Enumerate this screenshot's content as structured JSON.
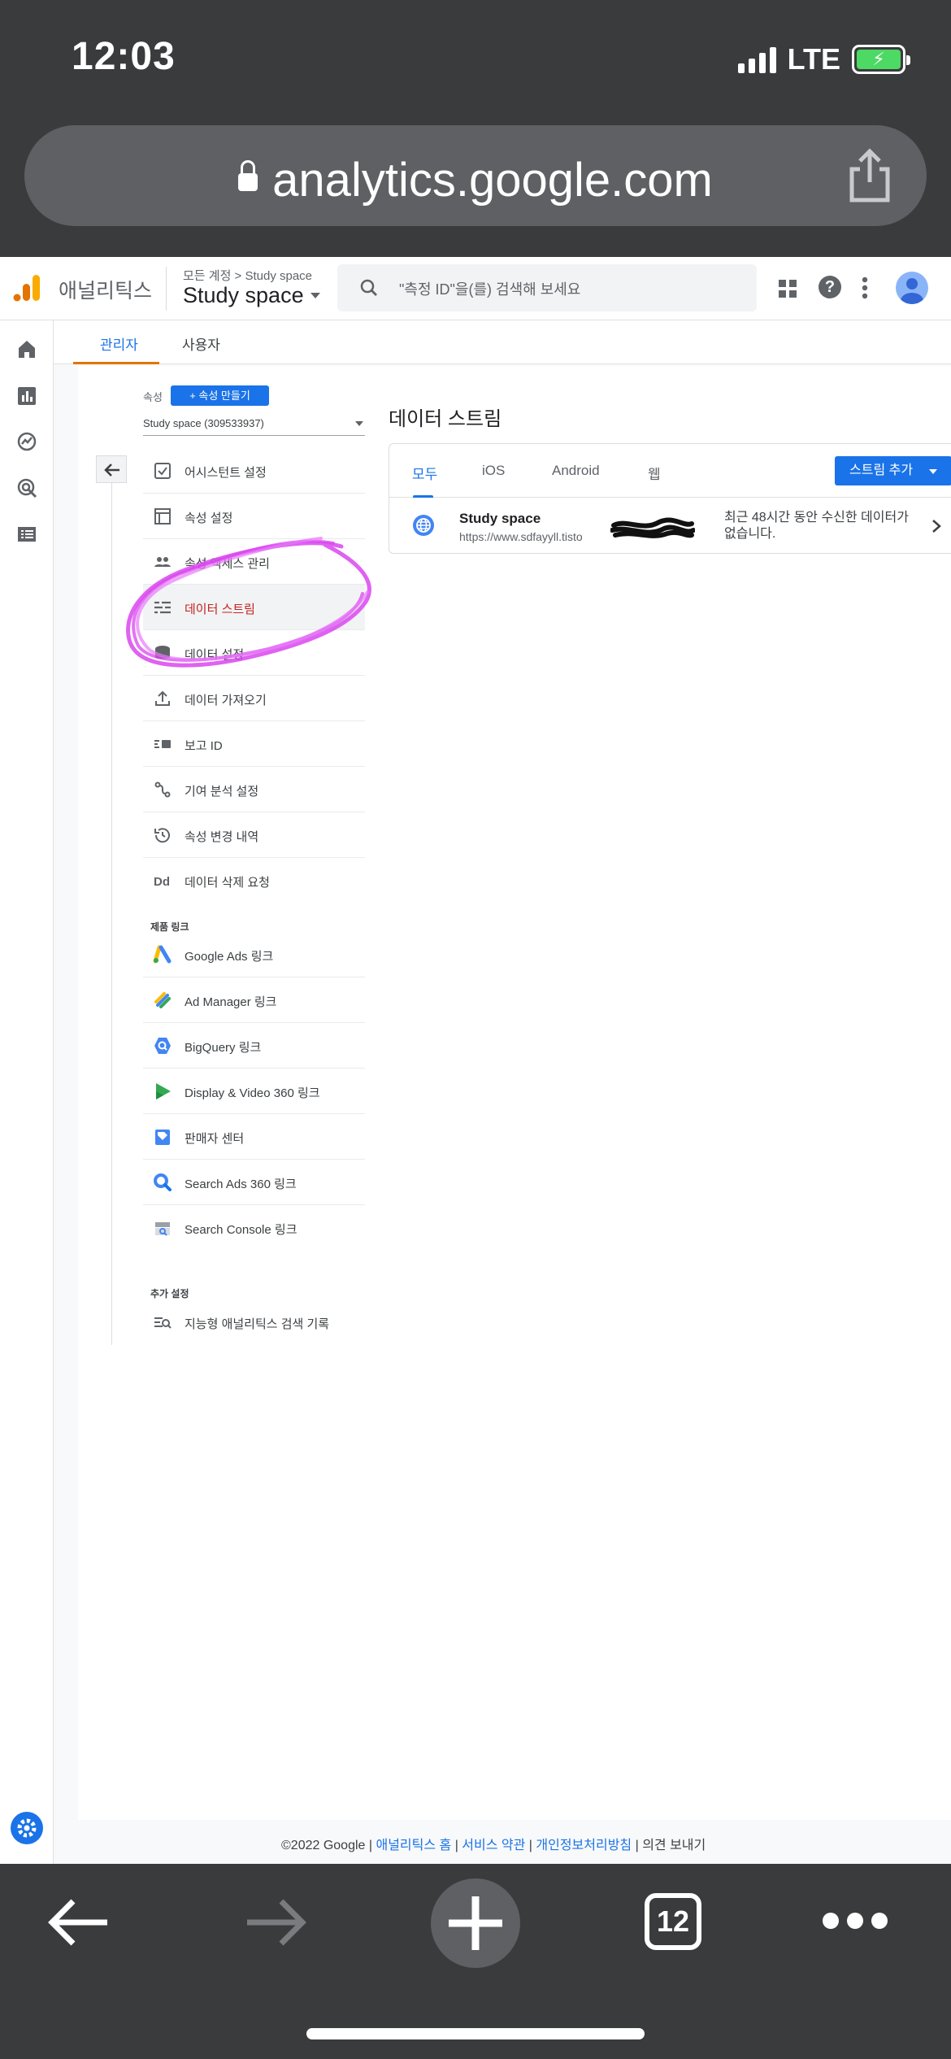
{
  "status_bar": {
    "time": "12:03",
    "network": "LTE"
  },
  "browser": {
    "url": "analytics.google.com",
    "tab_count": "12"
  },
  "header": {
    "brand": "애널리틱스",
    "account_breadcrumb": "모든 계정 > Study space",
    "account_name": "Study space",
    "search_placeholder": "\"측정 ID\"을(를) 검색해 보세요"
  },
  "admin_tabs": [
    {
      "label": "관리자",
      "active": true
    },
    {
      "label": "사용자",
      "active": false
    }
  ],
  "property": {
    "label": "속성",
    "create_button": "+ 속성 만들기",
    "selected": "Study space (309533937)"
  },
  "menu": {
    "items": [
      {
        "label": "어시스턴트 설정",
        "icon": "checklist-icon"
      },
      {
        "label": "속성 설정",
        "icon": "property-settings-icon"
      },
      {
        "label": "속성 액세스 관리",
        "icon": "people-icon"
      },
      {
        "label": "데이터 스트림",
        "icon": "data-stream-icon",
        "active": true
      },
      {
        "label": "데이터 설정",
        "icon": "database-icon"
      },
      {
        "label": "데이터 가져오기",
        "icon": "upload-icon"
      },
      {
        "label": "보고 ID",
        "icon": "reporting-id-icon"
      },
      {
        "label": "기여 분석 설정",
        "icon": "attribution-icon"
      },
      {
        "label": "속성 변경 내역",
        "icon": "history-icon"
      },
      {
        "label": "데이터 삭제 요청",
        "icon": "data-deletion-icon"
      }
    ],
    "product_links_header": "제품 링크",
    "product_links": [
      {
        "label": "Google Ads 링크",
        "icon": "google-ads-icon"
      },
      {
        "label": "Ad Manager 링크",
        "icon": "ad-manager-icon"
      },
      {
        "label": "BigQuery 링크",
        "icon": "bigquery-icon"
      },
      {
        "label": "Display & Video 360 링크",
        "icon": "display-video-360-icon"
      },
      {
        "label": "판매자 센터",
        "icon": "merchant-center-icon"
      },
      {
        "label": "Search Ads 360 링크",
        "icon": "search-ads-360-icon"
      },
      {
        "label": "Search Console 링크",
        "icon": "search-console-icon"
      }
    ],
    "additional_header": "추가 설정",
    "additional": [
      {
        "label": "지능형 애널리틱스 검색 기록",
        "icon": "search-history-icon"
      }
    ]
  },
  "content": {
    "title": "데이터 스트림",
    "stream_tabs": [
      {
        "label": "모두",
        "active": true
      },
      {
        "label": "iOS",
        "active": false
      },
      {
        "label": "Android",
        "active": false
      },
      {
        "label": "웹",
        "active": false
      }
    ],
    "add_stream_button": "스트림 추가",
    "streams": [
      {
        "name": "Study space",
        "url": "https://www.sdfayyll.tisto",
        "status": "최근 48시간 동안 수신한 데이터가 없습니다."
      }
    ]
  },
  "footer": {
    "copyright": "©2022 Google |",
    "links": [
      "애널리틱스 홈",
      "서비스 약관",
      "개인정보처리방침"
    ],
    "feedback": "의견 보내기"
  },
  "colors": {
    "primary": "#1a73e8",
    "active_menu_text": "#c5221f",
    "tab_accent": "#e37400",
    "annotation": "#d946ef",
    "ios_chrome": "#3a3b3d"
  }
}
